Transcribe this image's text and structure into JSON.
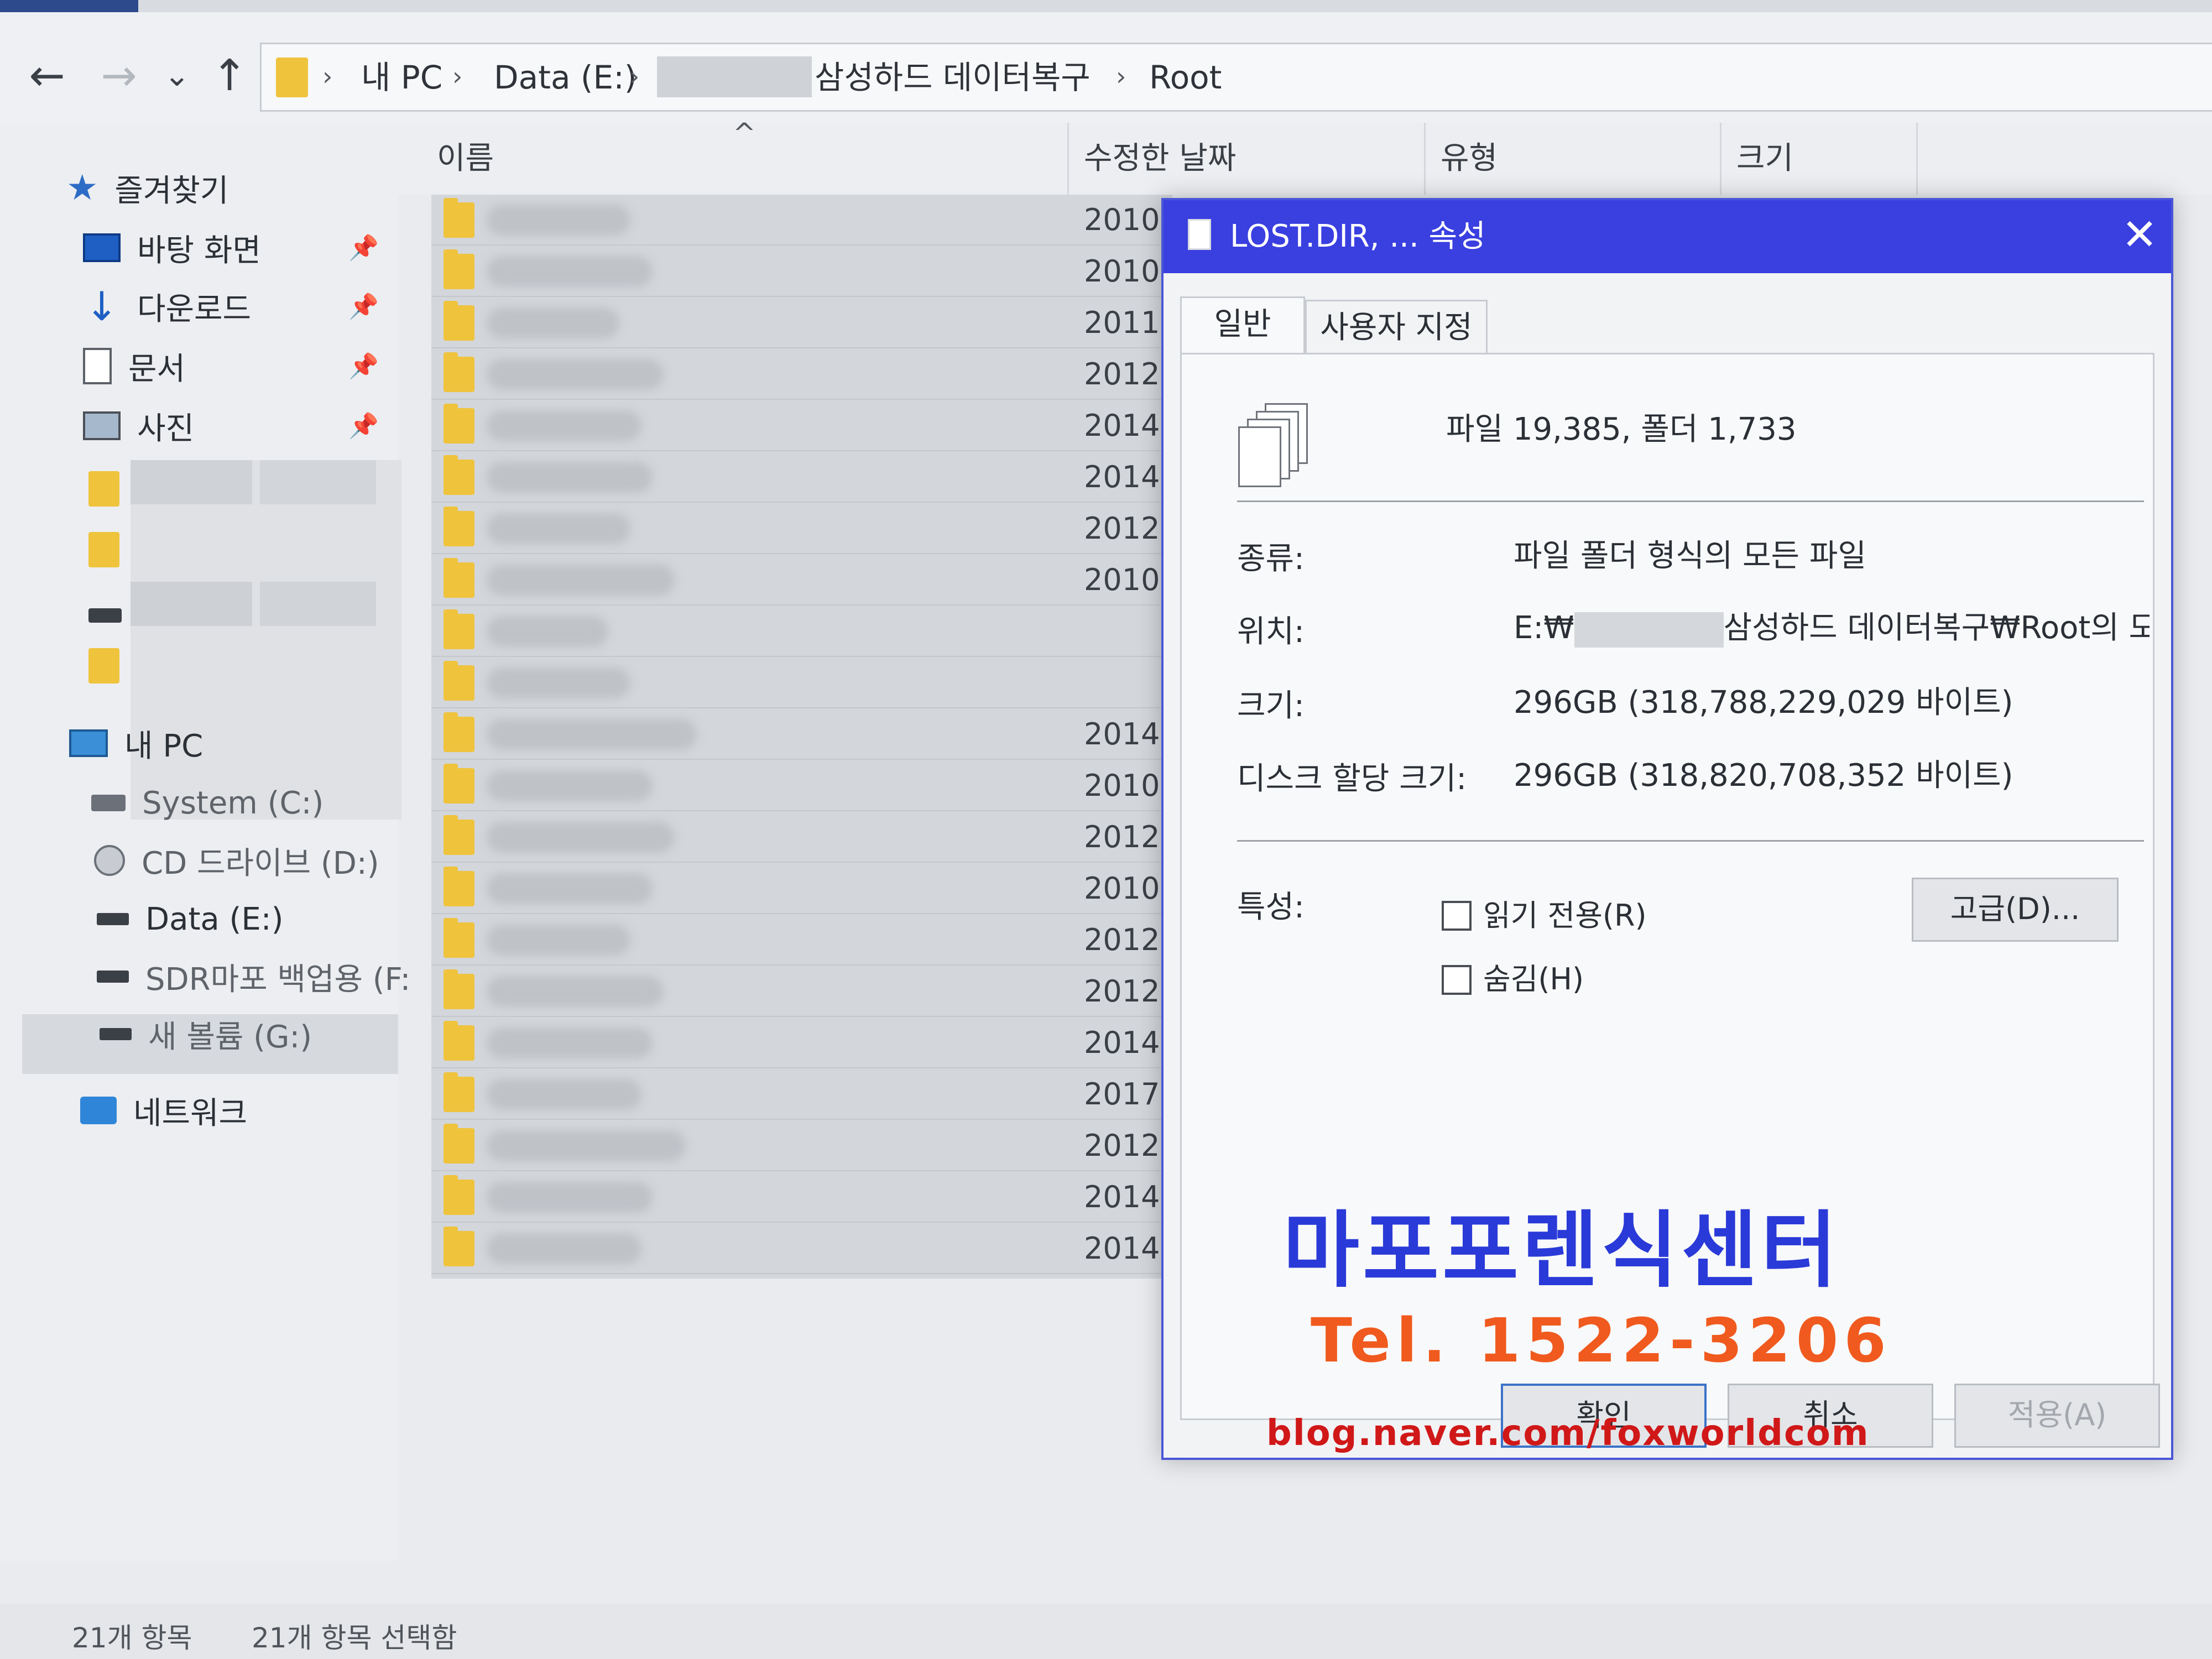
{
  "explorer": {
    "nav": {
      "back": "←",
      "forward": "→",
      "recent": "⌄",
      "up": "↑"
    },
    "breadcrumb": [
      "내 PC",
      "Data (E:)",
      "삼성하드 데이터복구",
      "Root"
    ],
    "columns": {
      "name": "이름",
      "modified": "수정한 날짜",
      "type": "유형",
      "size": "크기"
    },
    "sidebar": {
      "quick_access": "즐겨찾기",
      "desktop": "바탕 화면",
      "downloads": "다운로드",
      "documents": "문서",
      "pictures": "사진",
      "this_pc": "내 PC",
      "drive_c": "System (C:)",
      "drive_d": "CD 드라이브 (D:)",
      "drive_e": "Data (E:)",
      "drive_f": "SDR마포 백업용 (F:",
      "drive_g": "새 볼륨 (G:)",
      "network": "네트워크"
    },
    "rows": [
      {
        "date": "2010-"
      },
      {
        "date": "2010-"
      },
      {
        "date": "2011-"
      },
      {
        "date": "2012-"
      },
      {
        "date": "2014-"
      },
      {
        "date": "2014-"
      },
      {
        "date": "2012-"
      },
      {
        "date": "2010-"
      },
      {
        "date": ""
      },
      {
        "date": ""
      },
      {
        "date": "2014-"
      },
      {
        "date": "2010-"
      },
      {
        "date": "2012-"
      },
      {
        "date": "2010-"
      },
      {
        "date": "2012-"
      },
      {
        "date": "2012-"
      },
      {
        "date": "2014-"
      },
      {
        "date": "2017-"
      },
      {
        "date": "2012-"
      },
      {
        "date": "2014-"
      },
      {
        "date": "2014-"
      }
    ],
    "status": {
      "items": "21개 항목",
      "selected": "21개 항목 선택함"
    }
  },
  "dialog": {
    "title": "LOST.DIR, ... 속성",
    "close": "✕",
    "tabs": [
      "일반",
      "사용자 지정"
    ],
    "summary": "파일 19,385, 폴더 1,733",
    "fields": {
      "type_label": "종류:",
      "type_value": "파일 폴더 형식의 모든 파일",
      "location_label": "위치:",
      "location_prefix": "E:₩",
      "location_suffix": "삼성하드 데이터복구₩Root의 모든",
      "size_label": "크기:",
      "size_value": "296GB (318,788,229,029 바이트)",
      "disk_label": "디스크 할당 크기:",
      "disk_value": "296GB (318,820,708,352 바이트)",
      "attr_label": "특성:"
    },
    "readonly_label": "읽기 전용(R)",
    "hidden_label": "숨김(H)",
    "advanced_button": "고급(D)...",
    "ok_button": "확인",
    "cancel_button": "취소",
    "apply_button": "적용(A)"
  },
  "watermark": {
    "name": "마포포렌식센터",
    "tel": "Tel. 1522-3206",
    "blog": "blog.naver.com/foxworldcom"
  },
  "colors": {
    "titlebar": "#3a3fe0",
    "folder": "#efc33c",
    "wm_blue": "#2a3ad8",
    "wm_orange": "#f05a1e",
    "wm_red": "#d01818"
  }
}
